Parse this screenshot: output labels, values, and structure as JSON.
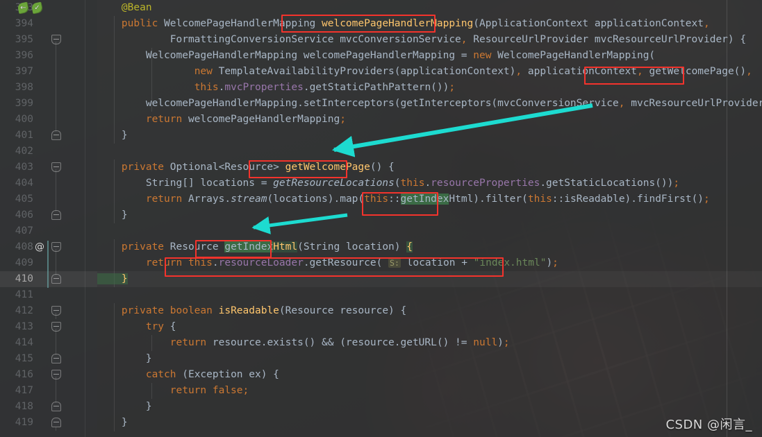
{
  "editor": {
    "first_line": 393,
    "current_line": 410,
    "watermark": "CSDN @闲言_",
    "colors": {
      "background": "#2b2b2b",
      "gutter": "#313335",
      "line_number": "#606366",
      "default_text": "#a9b7c6",
      "keyword": "#cc7832",
      "string": "#6a8759",
      "annotation": "#bbb529",
      "field": "#9876aa",
      "method": "#ffc66d",
      "number": "#6897bb",
      "selection": "#3b6b45",
      "annotation_box": "#f4332c",
      "arrow": "#1ddbd0"
    },
    "gutter_icons": [
      {
        "line": 393,
        "name": "spring-bean-override-icon"
      },
      {
        "line": 393,
        "name": "spring-bean-icon"
      },
      {
        "line": 408,
        "name": "at-annotation-icon",
        "glyph": "@"
      }
    ],
    "lines": [
      {
        "n": 393,
        "text": "    @Bean"
      },
      {
        "n": 394,
        "text": "    public WelcomePageHandlerMapping welcomePageHandlerMapping(ApplicationContext applicationContext,"
      },
      {
        "n": 395,
        "text": "            FormattingConversionService mvcConversionService, ResourceUrlProvider mvcResourceUrlProvider) {"
      },
      {
        "n": 396,
        "text": "        WelcomePageHandlerMapping welcomePageHandlerMapping = new WelcomePageHandlerMapping("
      },
      {
        "n": 397,
        "text": "                new TemplateAvailabilityProviders(applicationContext), applicationContext, getWelcomePage(),"
      },
      {
        "n": 398,
        "text": "                this.mvcProperties.getStaticPathPattern());"
      },
      {
        "n": 399,
        "text": "        welcomePageHandlerMapping.setInterceptors(getInterceptors(mvcConversionService, mvcResourceUrlProvider));"
      },
      {
        "n": 400,
        "text": "        return welcomePageHandlerMapping;"
      },
      {
        "n": 401,
        "text": "    }"
      },
      {
        "n": 402,
        "text": ""
      },
      {
        "n": 403,
        "text": "    private Optional<Resource> getWelcomePage() {"
      },
      {
        "n": 404,
        "text": "        String[] locations = getResourceLocations(this.resourceProperties.getStaticLocations());"
      },
      {
        "n": 405,
        "text": "        return Arrays.stream(locations).map(this::getIndexHtml).filter(this::isReadable).findFirst();"
      },
      {
        "n": 406,
        "text": "    }"
      },
      {
        "n": 407,
        "text": ""
      },
      {
        "n": 408,
        "text": "    private Resource getIndexHtml(String location) {"
      },
      {
        "n": 409,
        "text": "        return this.resourceLoader.getResource( S: location + \"index.html\");"
      },
      {
        "n": 410,
        "text": "    }"
      },
      {
        "n": 411,
        "text": ""
      },
      {
        "n": 412,
        "text": "    private boolean isReadable(Resource resource) {"
      },
      {
        "n": 413,
        "text": "        try {"
      },
      {
        "n": 414,
        "text": "            return resource.exists() && (resource.getURL() != null);"
      },
      {
        "n": 415,
        "text": "        }"
      },
      {
        "n": 416,
        "text": "        catch (Exception ex) {"
      },
      {
        "n": 417,
        "text": "            return false;"
      },
      {
        "n": 418,
        "text": "        }"
      },
      {
        "n": 419,
        "text": "    }"
      }
    ],
    "selection": {
      "text": "getIndex",
      "occurrences": [
        "line 405 this::getIndexHtml",
        "line 408 getIndexHtml"
      ]
    },
    "parameter_hint": "S:",
    "annotations": {
      "highlight_boxes": [
        {
          "name": "welcomePageHandlerMapping-method-name",
          "label": "welcomePageHandlerMapping"
        },
        {
          "name": "getWelcomePage-call",
          "label": "getWelcomePage(),"
        },
        {
          "name": "getWelcomePage-declaration",
          "label": "getWelcomePage()"
        },
        {
          "name": "getIndexHtml-reference",
          "label": "getIndexHtml)."
        },
        {
          "name": "getIndexHtml-declaration",
          "label": "getIndexHtml("
        },
        {
          "name": "getResource-return-statement",
          "label": "this.resourceLoader.getResource( S: location + \"index.html\");"
        }
      ],
      "arrows": [
        {
          "name": "arrow-getWelcomePage",
          "from": "getWelcomePage() call on line 397",
          "to": "getWelcomePage() declaration on line 403"
        },
        {
          "name": "arrow-getIndexHtml",
          "from": "getIndexHtml reference on line 405",
          "to": "getIndexHtml declaration on line 408"
        }
      ]
    }
  }
}
